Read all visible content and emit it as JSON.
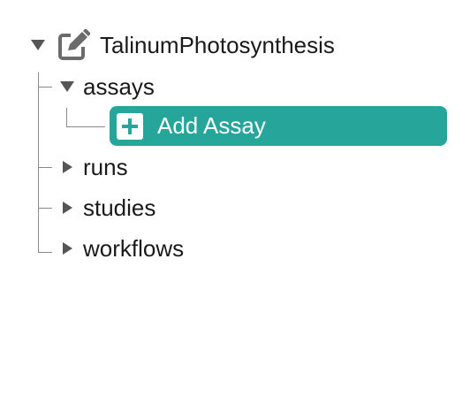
{
  "tree": {
    "root": {
      "label": "TalinumPhotosynthesis",
      "icon": "edit-icon",
      "expanded": true
    },
    "children": [
      {
        "label": "assays",
        "expanded": true,
        "children": [
          {
            "label": "Add Assay",
            "type": "action",
            "icon": "plus-square-icon"
          }
        ]
      },
      {
        "label": "runs",
        "expanded": false
      },
      {
        "label": "studies",
        "expanded": false
      },
      {
        "label": "workflows",
        "expanded": false
      }
    ]
  },
  "colors": {
    "accent": "#26a69a",
    "tree_line": "#8a8a8a",
    "caret": "#555555",
    "icon": "#6b6b6b"
  }
}
